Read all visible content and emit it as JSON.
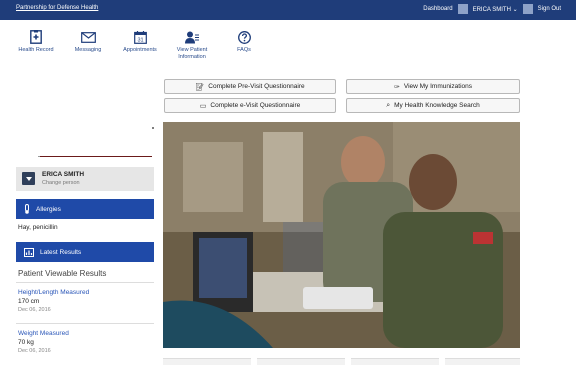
{
  "topbar": {
    "brand": "Partnership for Defense Health",
    "links": [
      "Dashboard",
      "ERICA SMITH",
      "Sign Out"
    ],
    "user_caret": "⌄"
  },
  "nav": [
    {
      "label": "Health Record",
      "icon": "health-record-icon"
    },
    {
      "label": "Messaging",
      "icon": "envelope-icon"
    },
    {
      "label": "Appointments",
      "icon": "calendar-icon",
      "day": "31"
    },
    {
      "label": "View Patient Information",
      "icon": "patient-icon"
    },
    {
      "label": "FAQs",
      "icon": "question-icon"
    }
  ],
  "buttons": {
    "pre_visit": "Complete Pre-Visit Questionnaire",
    "immunizations": "View My Immunizations",
    "e_visit": "Complete e-Visit Questionnaire",
    "knowledge": "My Health Knowledge Search"
  },
  "person": {
    "name": "ERICA SMITH",
    "change": "Change person"
  },
  "allergies": {
    "title": "Allergies",
    "value": "Hay,  penicillin"
  },
  "latest": {
    "title": "Latest Results"
  },
  "results": {
    "title": "Patient Viewable Results",
    "items": [
      {
        "name": "Height/Length Measured",
        "value": "170 cm",
        "date": "Dec 06, 2016"
      },
      {
        "name": "Weight Measured",
        "value": "70 kg",
        "date": "Dec 06, 2016"
      }
    ]
  },
  "colors": {
    "topbar": "#1f3d7a",
    "section_bar": "#1f4aa8",
    "link": "#2a56b8"
  }
}
